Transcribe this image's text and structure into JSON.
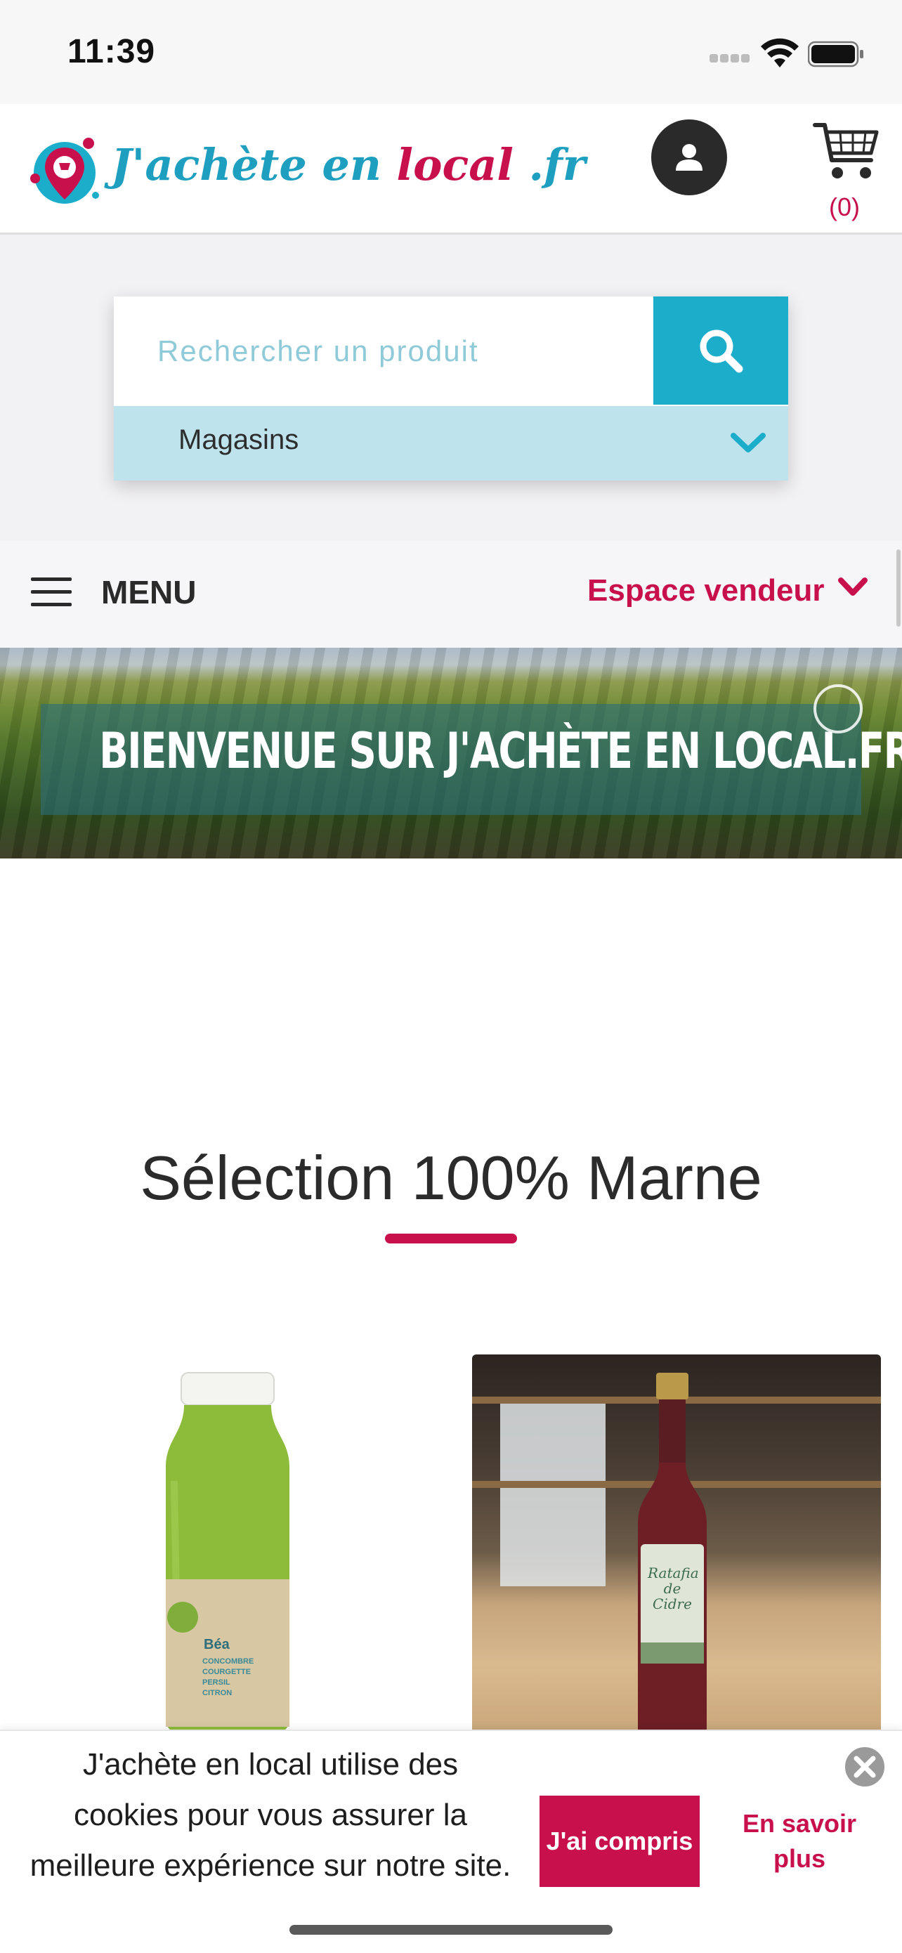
{
  "status_bar": {
    "time": "11:39"
  },
  "header": {
    "logo_text_main": "J'achète en ",
    "logo_text_accent": "local",
    "logo_text_suffix": " .fr",
    "cart_count": "(0)"
  },
  "search": {
    "placeholder": "Rechercher un produit",
    "store_select": "Magasins"
  },
  "menu": {
    "label": "MENU",
    "seller_link": "Espace vendeur"
  },
  "banner": {
    "title": "BIENVENUE SUR J'ACHÈTE EN LOCAL.FR"
  },
  "section": {
    "title": "Sélection 100% Marne"
  },
  "products": [
    {
      "label_brand": "Béa",
      "label_lines": [
        "CONCOMBRE",
        "COURGETTE",
        "PERSIL",
        "CITRON"
      ]
    },
    {
      "label_lines": [
        "Ratafia",
        "de",
        "Cidre"
      ]
    }
  ],
  "cookie": {
    "text": "J'achète en local utilise des cookies pour vous assurer la meilleure expérience sur notre site.",
    "accept": "J'ai compris",
    "more": "En savoir plus"
  },
  "colors": {
    "brand_blue": "#1cadca",
    "brand_pink": "#c7104c"
  }
}
